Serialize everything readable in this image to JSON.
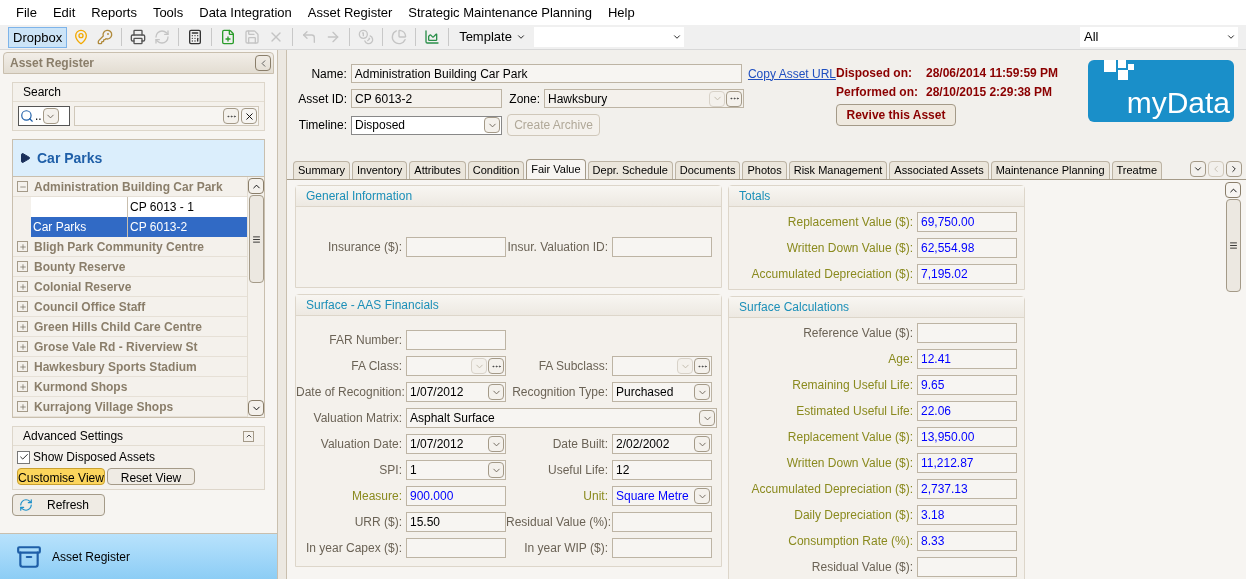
{
  "menu": [
    "File",
    "Edit",
    "Reports",
    "Tools",
    "Data Integration",
    "Asset Register",
    "Strategic Maintenance Planning",
    "Help"
  ],
  "toolbar": {
    "dropbox": {
      "label": "Dropbox",
      "selected": true
    },
    "icons": [
      {
        "disabled": false
      },
      {
        "disabled": false
      },
      {
        "disabled": false
      },
      {
        "disabled": true
      },
      {
        "disabled": false
      },
      {
        "disabled": false
      },
      {
        "disabled": true
      },
      {
        "disabled": true
      },
      {
        "disabled": true
      },
      {
        "disabled": true
      },
      {
        "disabled": true
      },
      {
        "disabled": true
      },
      {
        "disabled": false
      }
    ],
    "template": "Template",
    "filter": "All"
  },
  "sidebar": {
    "title": "Asset Register",
    "search": {
      "title": "Search",
      "mode": ".."
    },
    "category": "Car Parks",
    "tree": [
      {
        "label": "Administration Building Car Park",
        "expanded": true,
        "children": [
          {
            "asset_id": "CP 6013 - 1",
            "selected": false
          },
          {
            "category": "Car Parks",
            "asset_id": "CP 6013-2",
            "selected": true
          }
        ]
      },
      {
        "label": "Bligh Park Community Centre",
        "expanded": false
      },
      {
        "label": "Bounty Reserve",
        "expanded": false
      },
      {
        "label": "Colonial Reserve",
        "expanded": false
      },
      {
        "label": "Council Office Staff",
        "expanded": false
      },
      {
        "label": "Green Hills Child Care Centre",
        "expanded": false
      },
      {
        "label": "Grose Vale Rd - Riverview St",
        "expanded": false
      },
      {
        "label": "Hawkesbury Sports Stadium",
        "expanded": false
      },
      {
        "label": "Kurmond Shops",
        "expanded": false
      },
      {
        "label": "Kurrajong Village Shops",
        "expanded": false
      }
    ],
    "advanced": {
      "title": "Advanced Settings",
      "show_disposed": {
        "label": "Show Disposed Assets",
        "checked": true
      },
      "buttons": [
        {
          "label": "Customise View",
          "selected": true
        },
        {
          "label": "Reset View",
          "selected": false
        }
      ]
    },
    "refresh": "Refresh",
    "nav": "Asset Register"
  },
  "asset": {
    "name": {
      "label": "Name:",
      "value": "Administration Building Car Park"
    },
    "copy_link": "Copy Asset URL",
    "asset_id": {
      "label": "Asset ID:",
      "value": "CP 6013-2"
    },
    "zone": {
      "label": "Zone:",
      "value": "Hawksbury"
    },
    "timeline": {
      "label": "Timeline:",
      "value": "Disposed"
    },
    "create_archive": {
      "label": "Create Archive",
      "disabled": true
    },
    "disposed_on": {
      "label": "Disposed on:",
      "value": "28/06/2014 11:59:59 PM"
    },
    "performed_on": {
      "label": "Performed on:",
      "value": "28/10/2015 2:29:38 PM"
    },
    "revive": "Revive this Asset",
    "logo": "myData"
  },
  "tabs": [
    {
      "label": "Summary",
      "selected": false
    },
    {
      "label": "Inventory",
      "selected": false
    },
    {
      "label": "Attributes",
      "selected": false
    },
    {
      "label": "Condition",
      "selected": false
    },
    {
      "label": "Fair Value",
      "selected": true
    },
    {
      "label": "Depr. Schedule",
      "selected": false
    },
    {
      "label": "Documents",
      "selected": false
    },
    {
      "label": "Photos",
      "selected": false
    },
    {
      "label": "Risk Management",
      "selected": false
    },
    {
      "label": "Associated Assets",
      "selected": false
    },
    {
      "label": "Maintenance Planning",
      "selected": false
    },
    {
      "label": "Treatme",
      "selected": false
    }
  ],
  "left_cards": [
    {
      "title": "General Information",
      "rows": [
        [
          {
            "label": "Insurance ($):",
            "kind": "text",
            "computed": false
          },
          {
            "label": "Insur. Valuation ID:",
            "kind": "text",
            "computed": false
          }
        ]
      ]
    },
    {
      "title": "Surface - AAS Financials",
      "rows": [
        [
          {
            "label": "FAR Number:",
            "kind": "text",
            "computed": false
          }
        ],
        [
          {
            "label": "FA Class:",
            "kind": "lookup",
            "computed": false
          },
          {
            "label": "FA Subclass:",
            "kind": "lookup",
            "computed": false
          }
        ],
        [
          {
            "label": "Date of Recognition:",
            "value": "1/07/2012",
            "kind": "combo",
            "computed": false
          },
          {
            "label": "Recognition Type:",
            "value": "Purchased",
            "kind": "combo",
            "computed": false
          }
        ],
        [
          {
            "label": "Valuation Matrix:",
            "value": "Asphalt Surface",
            "kind": "wide_combo",
            "computed": false
          }
        ],
        [
          {
            "label": "Valuation Date:",
            "value": "1/07/2012",
            "kind": "combo",
            "computed": false
          },
          {
            "label": "Date Built:",
            "value": "2/02/2002",
            "kind": "combo",
            "computed": false
          }
        ],
        [
          {
            "label": "SPI:",
            "value": "1",
            "kind": "combo",
            "computed": false
          },
          {
            "label": "Useful Life:",
            "value": "12",
            "kind": "text",
            "computed": false
          }
        ],
        [
          {
            "label": "Measure:",
            "value": "900.000",
            "kind": "text",
            "computed": true
          },
          {
            "label": "Unit:",
            "value": "Square Metre",
            "kind": "combo",
            "computed": true
          }
        ],
        [
          {
            "label": "URR ($):",
            "value": "15.50",
            "kind": "text",
            "computed": false
          },
          {
            "label": "Residual Value (%):",
            "kind": "text",
            "computed": false
          }
        ],
        [
          {
            "label": "In year Capex ($):",
            "kind": "text",
            "computed": false
          },
          {
            "label": "In year WIP ($):",
            "kind": "text",
            "computed": false
          }
        ]
      ]
    }
  ],
  "right_cards": [
    {
      "title": "Totals",
      "fields": [
        {
          "label": "Replacement Value ($):",
          "value": "69,750.00",
          "computed": true
        },
        {
          "label": "Written Down Value ($):",
          "value": "62,554.98",
          "computed": true
        },
        {
          "label": "Accumulated Depreciation ($):",
          "value": "7,195.02",
          "computed": true
        }
      ]
    },
    {
      "title": "Surface Calculations",
      "fields": [
        {
          "label": "Reference Value ($):",
          "computed": false
        },
        {
          "label": "Age:",
          "value": "12.41",
          "computed": true
        },
        {
          "label": "Remaining Useful Life:",
          "value": "9.65",
          "computed": true
        },
        {
          "label": "Estimated Useful Life:",
          "value": "22.06",
          "computed": true
        },
        {
          "label": "Replacement Value ($):",
          "value": "13,950.00",
          "computed": true
        },
        {
          "label": "Written Down Value ($):",
          "value": "11,212.87",
          "computed": true
        },
        {
          "label": "Accumulated Depreciation ($):",
          "value": "2,737.13",
          "computed": true
        },
        {
          "label": "Daily Depreciation ($):",
          "value": "3.18",
          "computed": true
        },
        {
          "label": "Consumption Rate (%):",
          "value": "8.33",
          "computed": true
        },
        {
          "label": "Residual Value ($):",
          "computed": false
        }
      ]
    }
  ]
}
